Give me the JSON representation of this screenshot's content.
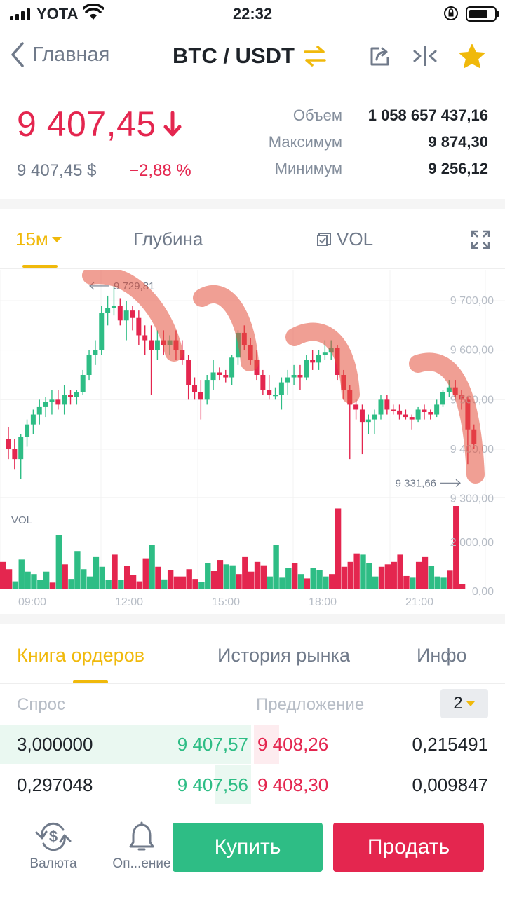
{
  "status_bar": {
    "carrier": "YOTA",
    "time": "22:32"
  },
  "nav": {
    "back_label": "Главная",
    "pair": "BTC / USDT"
  },
  "ticker": {
    "price": "9 407,45",
    "price_usd": "9 407,45 $",
    "change": "−2,88 %",
    "stats": [
      {
        "label": "Объем",
        "value": "1 058 657 437,16"
      },
      {
        "label": "Максимум",
        "value": "9 874,30"
      },
      {
        "label": "Минимум",
        "value": "9 256,12"
      }
    ]
  },
  "chart_tabs": {
    "interval": "15м",
    "depth": "Глубина",
    "vol": "VOL"
  },
  "chart_data": {
    "type": "candlestick",
    "interval": "15m",
    "high_marker": "9 729,81",
    "low_marker": "9 331,66",
    "price_ticks": [
      "9 700,00",
      "9 600,00",
      "9 500,00",
      "9 400,00",
      "9 300,00"
    ],
    "volume_label": "VOL",
    "volume_ticks": [
      "2 000,00",
      "0,00"
    ],
    "time_ticks": [
      "09:00",
      "12:00",
      "15:00",
      "18:00",
      "21:00"
    ],
    "candles": [
      [
        9420,
        9445,
        9380,
        9400
      ],
      [
        9400,
        9420,
        9360,
        9380
      ],
      [
        9380,
        9430,
        9340,
        9425
      ],
      [
        9425,
        9460,
        9405,
        9450
      ],
      [
        9450,
        9480,
        9430,
        9470
      ],
      [
        9470,
        9500,
        9450,
        9485
      ],
      [
        9485,
        9505,
        9465,
        9495
      ],
      [
        9495,
        9520,
        9470,
        9500
      ],
      [
        9500,
        9520,
        9480,
        9490
      ],
      [
        9490,
        9530,
        9470,
        9510
      ],
      [
        9510,
        9520,
        9490,
        9505
      ],
      [
        9505,
        9520,
        9490,
        9515
      ],
      [
        9515,
        9560,
        9510,
        9550
      ],
      [
        9550,
        9600,
        9540,
        9590
      ],
      [
        9590,
        9620,
        9570,
        9600
      ],
      [
        9600,
        9690,
        9590,
        9675
      ],
      [
        9675,
        9710,
        9650,
        9685
      ],
      [
        9685,
        9730,
        9670,
        9690
      ],
      [
        9690,
        9705,
        9650,
        9660
      ],
      [
        9660,
        9700,
        9620,
        9680
      ],
      [
        9680,
        9690,
        9640,
        9665
      ],
      [
        9665,
        9680,
        9610,
        9630
      ],
      [
        9630,
        9650,
        9590,
        9620
      ],
      [
        9620,
        9650,
        9510,
        9600
      ],
      [
        9600,
        9640,
        9580,
        9620
      ],
      [
        9620,
        9640,
        9590,
        9610
      ],
      [
        9610,
        9630,
        9590,
        9620
      ],
      [
        9620,
        9640,
        9580,
        9600
      ],
      [
        9600,
        9620,
        9570,
        9580
      ],
      [
        9580,
        9590,
        9500,
        9530
      ],
      [
        9530,
        9545,
        9500,
        9515
      ],
      [
        9515,
        9540,
        9460,
        9500
      ],
      [
        9500,
        9550,
        9490,
        9540
      ],
      [
        9540,
        9580,
        9520,
        9555
      ],
      [
        9555,
        9565,
        9540,
        9550
      ],
      [
        9550,
        9560,
        9535,
        9545
      ],
      [
        9545,
        9590,
        9530,
        9585
      ],
      [
        9585,
        9640,
        9570,
        9635
      ],
      [
        9635,
        9650,
        9600,
        9610
      ],
      [
        9610,
        9625,
        9570,
        9580
      ],
      [
        9580,
        9600,
        9540,
        9550
      ],
      [
        9550,
        9560,
        9510,
        9520
      ],
      [
        9520,
        9550,
        9500,
        9510
      ],
      [
        9510,
        9525,
        9500,
        9510
      ],
      [
        9510,
        9545,
        9480,
        9535
      ],
      [
        9535,
        9560,
        9510,
        9545
      ],
      [
        9545,
        9570,
        9530,
        9550
      ],
      [
        9550,
        9570,
        9520,
        9545
      ],
      [
        9545,
        9590,
        9540,
        9580
      ],
      [
        9580,
        9600,
        9560,
        9575
      ],
      [
        9575,
        9600,
        9560,
        9590
      ],
      [
        9590,
        9620,
        9580,
        9595
      ],
      [
        9595,
        9620,
        9580,
        9605
      ],
      [
        9605,
        9610,
        9540,
        9550
      ],
      [
        9550,
        9560,
        9500,
        9520
      ],
      [
        9520,
        9530,
        9380,
        9490
      ],
      [
        9490,
        9500,
        9460,
        9480
      ],
      [
        9480,
        9490,
        9390,
        9455
      ],
      [
        9455,
        9470,
        9430,
        9460
      ],
      [
        9460,
        9480,
        9430,
        9470
      ],
      [
        9470,
        9510,
        9460,
        9500
      ],
      [
        9500,
        9510,
        9470,
        9480
      ],
      [
        9480,
        9490,
        9470,
        9478
      ],
      [
        9478,
        9490,
        9460,
        9470
      ],
      [
        9470,
        9480,
        9460,
        9465
      ],
      [
        9465,
        9470,
        9440,
        9460
      ],
      [
        9460,
        9485,
        9455,
        9480
      ],
      [
        9480,
        9490,
        9460,
        9475
      ],
      [
        9475,
        9480,
        9460,
        9470
      ],
      [
        9470,
        9500,
        9465,
        9490
      ],
      [
        9490,
        9520,
        9485,
        9515
      ],
      [
        9515,
        9540,
        9505,
        9525
      ],
      [
        9525,
        9540,
        9500,
        9510
      ],
      [
        9510,
        9520,
        9480,
        9500
      ],
      [
        9500,
        9505,
        9370,
        9440
      ],
      [
        9440,
        9450,
        9400,
        9410
      ]
    ],
    "volumes": [
      1100,
      800,
      300,
      1200,
      700,
      600,
      350,
      700,
      250,
      2200,
      1000,
      400,
      1550,
      800,
      500,
      1300,
      900,
      350,
      1400,
      350,
      950,
      550,
      300,
      1250,
      1800,
      900,
      380,
      750,
      500,
      500,
      800,
      400,
      260,
      1050,
      720,
      1180,
      1000,
      960,
      600,
      1300,
      700,
      1100,
      960,
      500,
      1800,
      450,
      850,
      1050,
      600,
      420,
      850,
      750,
      500,
      600,
      3300,
      900,
      1100,
      1450,
      1400,
      1050,
      500,
      900,
      1000,
      1100,
      1400,
      520,
      450,
      1100,
      1300,
      940,
      500,
      450,
      740,
      3400,
      200
    ]
  },
  "order_book": {
    "tabs": [
      "Книга ордеров",
      "История рынка",
      "Инфо"
    ],
    "bid_label": "Спрос",
    "ask_label": "Предложение",
    "depth": "2",
    "rows": [
      {
        "bid_qty": "3,000000",
        "bid_price": "9 407,57",
        "ask_price": "9 408,26",
        "ask_qty": "0,215491",
        "bid_depth": 1.0,
        "ask_depth": 0.1
      },
      {
        "bid_qty": "0,297048",
        "bid_price": "9 407,56",
        "ask_price": "9 408,30",
        "ask_qty": "0,009847",
        "bid_depth": 0.15,
        "ask_depth": 0.0
      }
    ]
  },
  "bottom_bar": {
    "currency_label": "Валюта",
    "alert_label": "Оп...ение",
    "buy_label": "Купить",
    "sell_label": "Продать"
  },
  "colors": {
    "up": "#2ebd85",
    "down": "#e4264f",
    "accent": "#f0b90b"
  }
}
